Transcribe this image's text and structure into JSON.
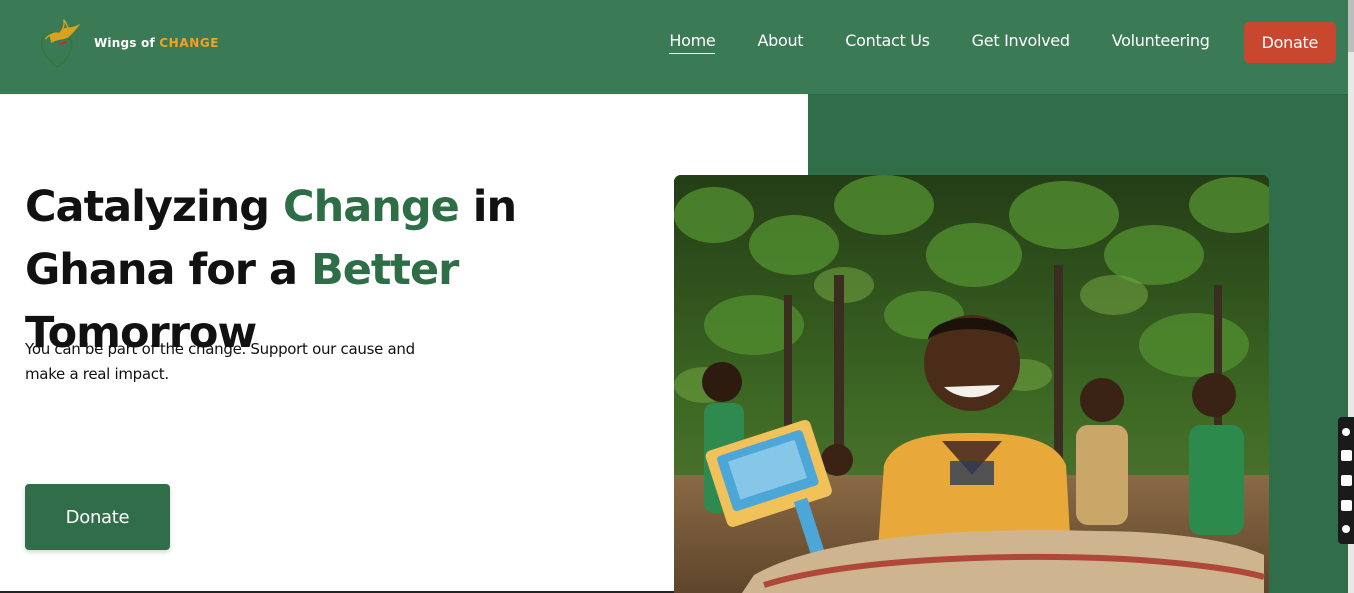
{
  "brand": {
    "name_prefix": "Wings of",
    "name_accent": "CHANGE",
    "logo_icon": "bird-africa-logo-icon",
    "accent_color": "#f2a31d"
  },
  "nav": {
    "items": [
      {
        "label": "Home",
        "active": true
      },
      {
        "label": "About",
        "active": false
      },
      {
        "label": "Contact Us",
        "active": false
      },
      {
        "label": "Get Involved",
        "active": false
      },
      {
        "label": "Volunteering",
        "active": false
      }
    ],
    "donate_label": "Donate"
  },
  "hero": {
    "title_part1": "Catalyzing ",
    "title_green1": "Change",
    "title_part2": " in Ghana for a ",
    "title_green2": "Better",
    "title_part3": " Tomorrow",
    "subtitle": "You can be part of the change. Support our cause and make a real impact.",
    "donate_label": "Donate",
    "image_icon": "children-photo"
  },
  "colors": {
    "primary_green": "#2f6e48",
    "header_green": "#3a7a55",
    "donate_red": "#c9472f",
    "heading_text": "#111111"
  }
}
